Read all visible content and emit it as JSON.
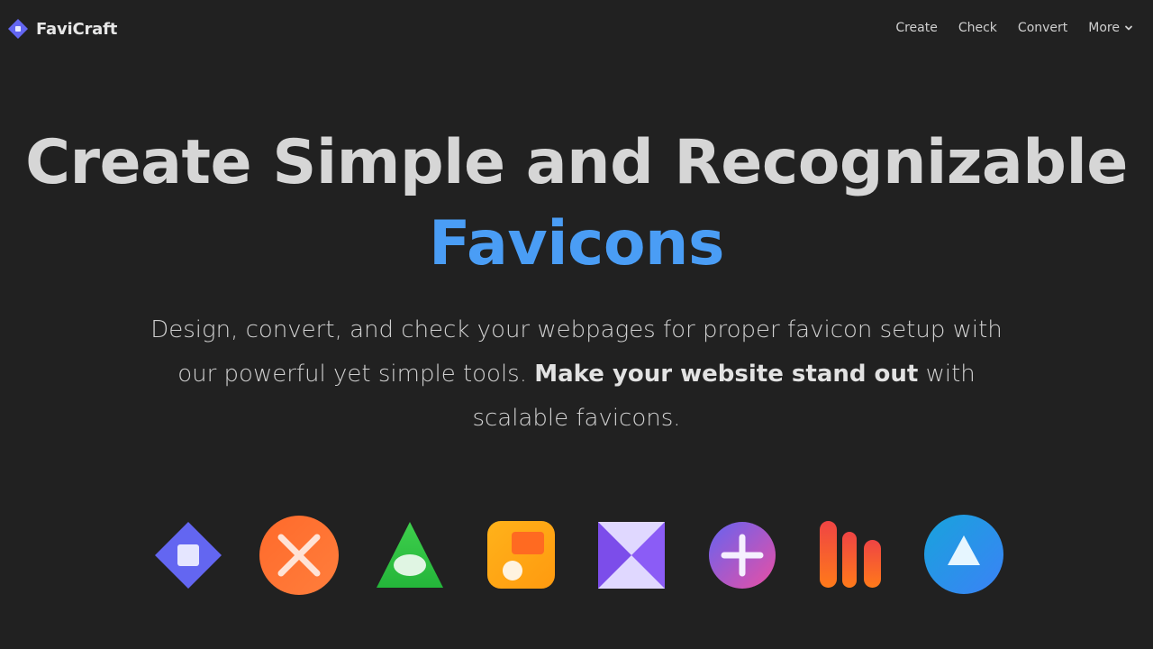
{
  "header": {
    "brand_name": "FaviCraft",
    "brand_icon": "diamond-logo-icon",
    "nav": [
      {
        "label": "Create"
      },
      {
        "label": "Check"
      },
      {
        "label": "Convert"
      },
      {
        "label": "More",
        "icon": "chevron-down-icon"
      }
    ]
  },
  "hero": {
    "title_line1": "Create Simple and Recognizable",
    "title_line2": "Favicons",
    "subtitle_part1": "Design, convert, and check your webpages for proper favicon setup with our powerful yet simple tools.",
    "subtitle_bold": "Make your website stand out",
    "subtitle_part2": "with scalable favicons."
  },
  "colors": {
    "background": "#212121",
    "accent": "#4a9df5",
    "brand": "#6366f1"
  },
  "favicon_examples": [
    {
      "icon": "diamond-square-icon"
    },
    {
      "icon": "x-circle-icon"
    },
    {
      "icon": "triangle-ellipse-icon"
    },
    {
      "icon": "rounded-square-dot-icon"
    },
    {
      "icon": "hourglass-square-icon"
    },
    {
      "icon": "plus-circle-icon"
    },
    {
      "icon": "bar-chart-icon"
    },
    {
      "icon": "triangle-circle-icon"
    }
  ]
}
